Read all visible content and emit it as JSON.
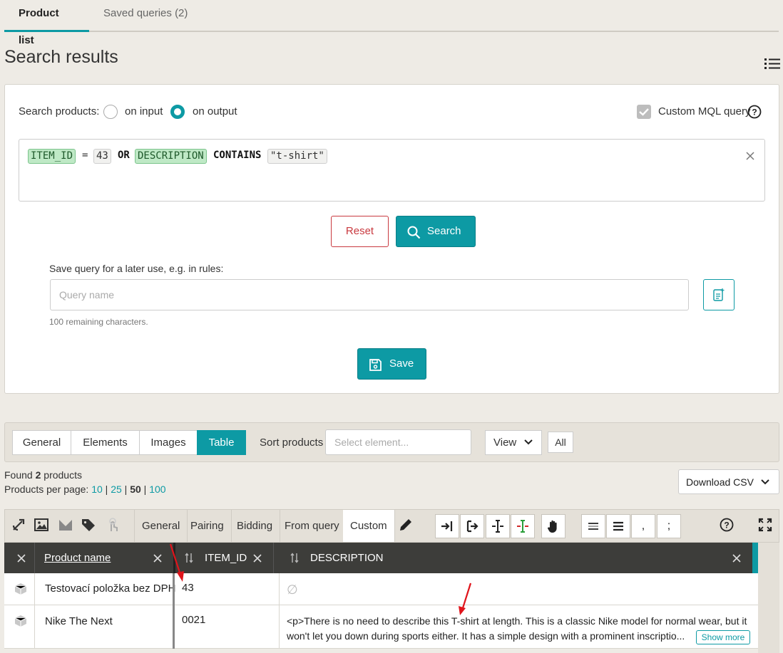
{
  "top_tabs": [
    {
      "label": "Product list",
      "active": true
    },
    {
      "label": "Saved queries (2)",
      "active": false
    }
  ],
  "page_title": "Search results",
  "search": {
    "label": "Search products:",
    "option_input": "on input",
    "option_output": "on output",
    "selected": "on output",
    "custom_mql_label": "Custom MQL query",
    "custom_mql_checked": true,
    "query_tokens": [
      {
        "text": "ITEM_ID",
        "kind": "field"
      },
      {
        "text": "=",
        "kind": "plain"
      },
      {
        "text": "43",
        "kind": "val"
      },
      {
        "text": "OR",
        "kind": "kw"
      },
      {
        "text": "DESCRIPTION",
        "kind": "field"
      },
      {
        "text": "CONTAINS",
        "kind": "kw"
      },
      {
        "text": "\"t-shirt\"",
        "kind": "val"
      }
    ],
    "clear_icon": "close-icon",
    "reset_label": "Reset",
    "search_label": "Search"
  },
  "save_query": {
    "label": "Save query for a later use, e.g. in rules:",
    "placeholder": "Query name",
    "remaining": "100 remaining characters.",
    "save_label": "Save"
  },
  "view_tabs": [
    {
      "label": "General",
      "active": false
    },
    {
      "label": "Elements",
      "active": false
    },
    {
      "label": "Images",
      "active": false
    },
    {
      "label": "Table",
      "active": true
    }
  ],
  "sort": {
    "label": "Sort products",
    "placeholder": "Select element...",
    "view_label": "View",
    "all_label": "All"
  },
  "results": {
    "found_prefix": "Found ",
    "found_count": "2",
    "found_suffix": " products",
    "per_page_label": "Products per page:",
    "per_page_options": [
      "10",
      "25",
      "50",
      "100"
    ],
    "per_page_selected": "50",
    "download_label": "Download CSV"
  },
  "grid_toolbar": {
    "tabs": [
      "General",
      "Pairing",
      "Bidding",
      "From query",
      "Custom"
    ],
    "active_tab": "Custom"
  },
  "columns": [
    {
      "label": "Product name"
    },
    {
      "label": "ITEM_ID"
    },
    {
      "label": "DESCRIPTION"
    }
  ],
  "rows": [
    {
      "name": "Testovací položka bez DPH",
      "item_id": "43",
      "description": "∅"
    },
    {
      "name": "Nike The Next",
      "item_id": "0021",
      "description": "<p>There is no need to describe this T-shirt at length. This is a classic Nike model for normal wear, but it won't let you down during sports either. It has a simple design with a prominent inscriptio..."
    }
  ],
  "show_more_label": "Show more",
  "colors": {
    "accent": "#0d9aa4",
    "danger": "#c9393f",
    "header_dark": "#3d3d3a",
    "annotation": "#e0141b"
  }
}
